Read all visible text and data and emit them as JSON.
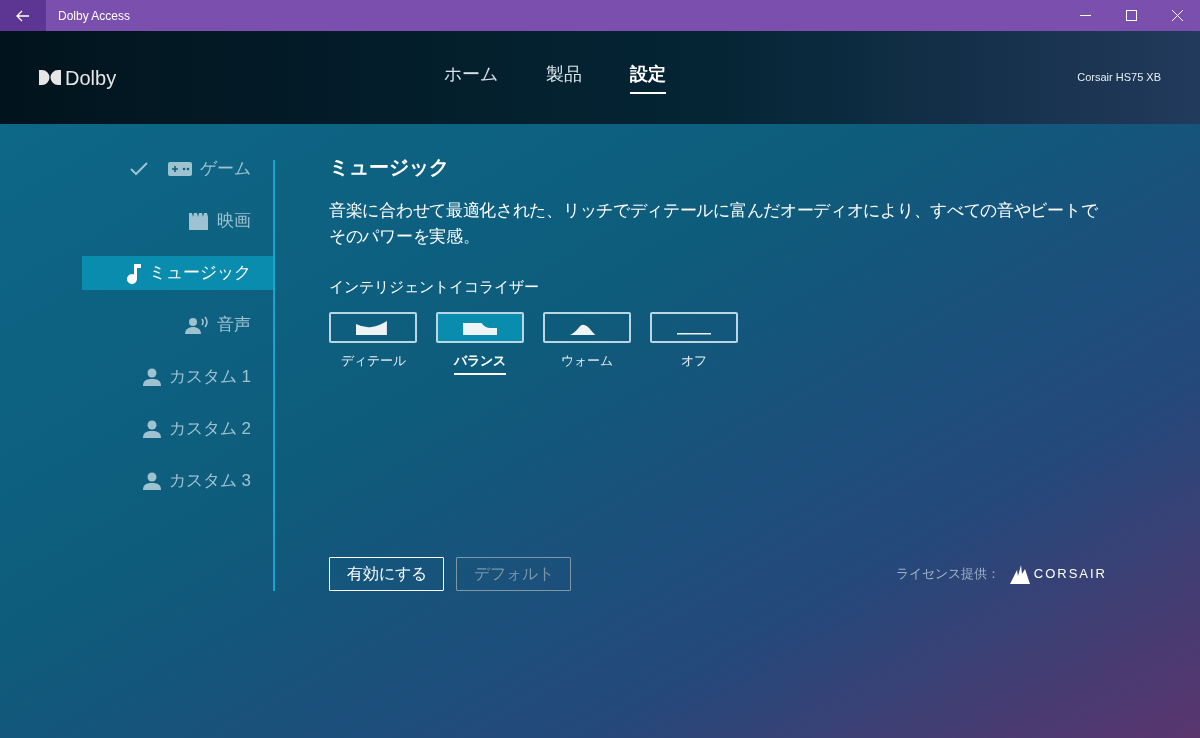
{
  "window": {
    "title": "Dolby Access"
  },
  "header": {
    "logo_text": "Dolby",
    "device": "Corsair HS75 XB"
  },
  "tabs": [
    {
      "label": "ホーム",
      "selected": false
    },
    {
      "label": "製品",
      "selected": false
    },
    {
      "label": "設定",
      "selected": true
    }
  ],
  "sidebar": {
    "items": [
      {
        "label": "ゲーム",
        "kind": "game",
        "checked": true,
        "selected": false
      },
      {
        "label": "映画",
        "kind": "movie",
        "checked": false,
        "selected": false
      },
      {
        "label": "ミュージック",
        "kind": "music",
        "checked": false,
        "selected": true
      },
      {
        "label": "音声",
        "kind": "voice",
        "checked": false,
        "selected": false
      },
      {
        "label": "カスタム 1",
        "kind": "custom",
        "checked": false,
        "selected": false
      },
      {
        "label": "カスタム 2",
        "kind": "custom",
        "checked": false,
        "selected": false
      },
      {
        "label": "カスタム 3",
        "kind": "custom",
        "checked": false,
        "selected": false
      }
    ]
  },
  "content": {
    "title": "ミュージック",
    "description": "音楽に合わせて最適化された、リッチでディテールに富んだオーディオにより、すべての音やビートでそのパワーを実感。",
    "eq_label": "インテリジェントイコライザー",
    "presets": [
      {
        "label": "ディテール",
        "kind": "detail",
        "selected": false
      },
      {
        "label": "バランス",
        "kind": "balance",
        "selected": true
      },
      {
        "label": "ウォーム",
        "kind": "warm",
        "selected": false
      },
      {
        "label": "オフ",
        "kind": "off",
        "selected": false
      }
    ],
    "buttons": [
      {
        "label": "有効にする",
        "disabled": false
      },
      {
        "label": "デフォルト",
        "disabled": true
      }
    ],
    "license": {
      "label": "ライセンス提供：",
      "brand": "CORSAIR"
    }
  }
}
